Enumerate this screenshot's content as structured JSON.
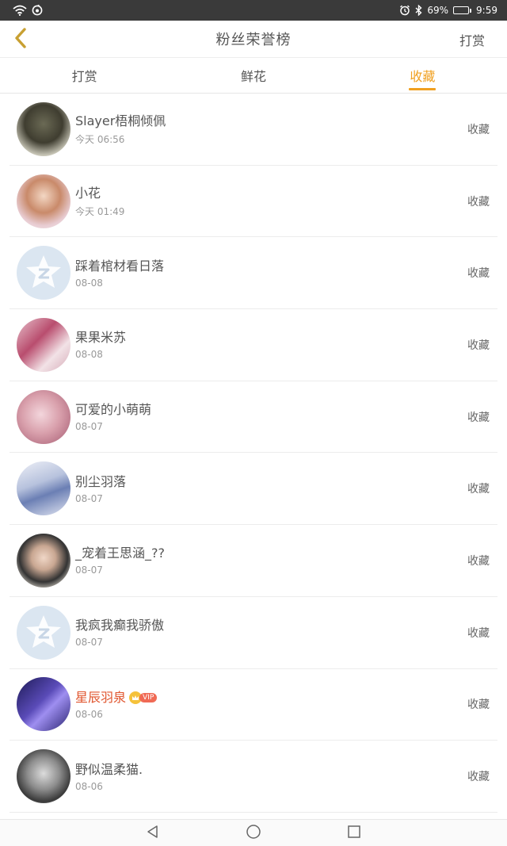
{
  "status_bar": {
    "battery_percent": "69%",
    "battery_level": 0.69,
    "time": "9:59",
    "icons": [
      "wifi-icon",
      "notification-app-icon",
      "alarm-icon",
      "bluetooth-icon",
      "battery-icon"
    ]
  },
  "header": {
    "title": "粉丝荣誉榜",
    "action_label": "打赏",
    "back_icon": "chevron-left-icon",
    "accent_color": "#c8a032"
  },
  "tabs": [
    {
      "label": "打赏",
      "active": false
    },
    {
      "label": "鲜花",
      "active": false
    },
    {
      "label": "收藏",
      "active": true
    }
  ],
  "theme": {
    "accent": "#f0a020",
    "vip_name_color": "#e0552e"
  },
  "fans": [
    {
      "name": "Slayer梧桐倾佩",
      "time": "今天 06:56",
      "action": "收藏",
      "avatar": "photo"
    },
    {
      "name": "小花",
      "time": "今天 01:49",
      "action": "收藏",
      "avatar": "photo"
    },
    {
      "name": "踩着棺材看日落",
      "time": "08-08",
      "action": "收藏",
      "avatar": "default"
    },
    {
      "name": "果果米苏",
      "time": "08-08",
      "action": "收藏",
      "avatar": "photo"
    },
    {
      "name": "可爱的小萌萌",
      "time": "08-07",
      "action": "收藏",
      "avatar": "photo"
    },
    {
      "name": "别尘羽落",
      "time": "08-07",
      "action": "收藏",
      "avatar": "photo"
    },
    {
      "name": "_宠着王思涵_??",
      "time": "08-07",
      "action": "收藏",
      "avatar": "photo"
    },
    {
      "name": "我疯我癫我骄傲",
      "time": "08-07",
      "action": "收藏",
      "avatar": "default"
    },
    {
      "name": "星辰羽泉",
      "time": "08-06",
      "action": "收藏",
      "avatar": "photo",
      "vip": true,
      "vip_label": "VIP"
    },
    {
      "name": "野似温柔猫.",
      "time": "08-06",
      "action": "收藏",
      "avatar": "photo"
    }
  ],
  "nav_bar": [
    "back-triangle-icon",
    "home-circle-icon",
    "recents-square-icon"
  ]
}
